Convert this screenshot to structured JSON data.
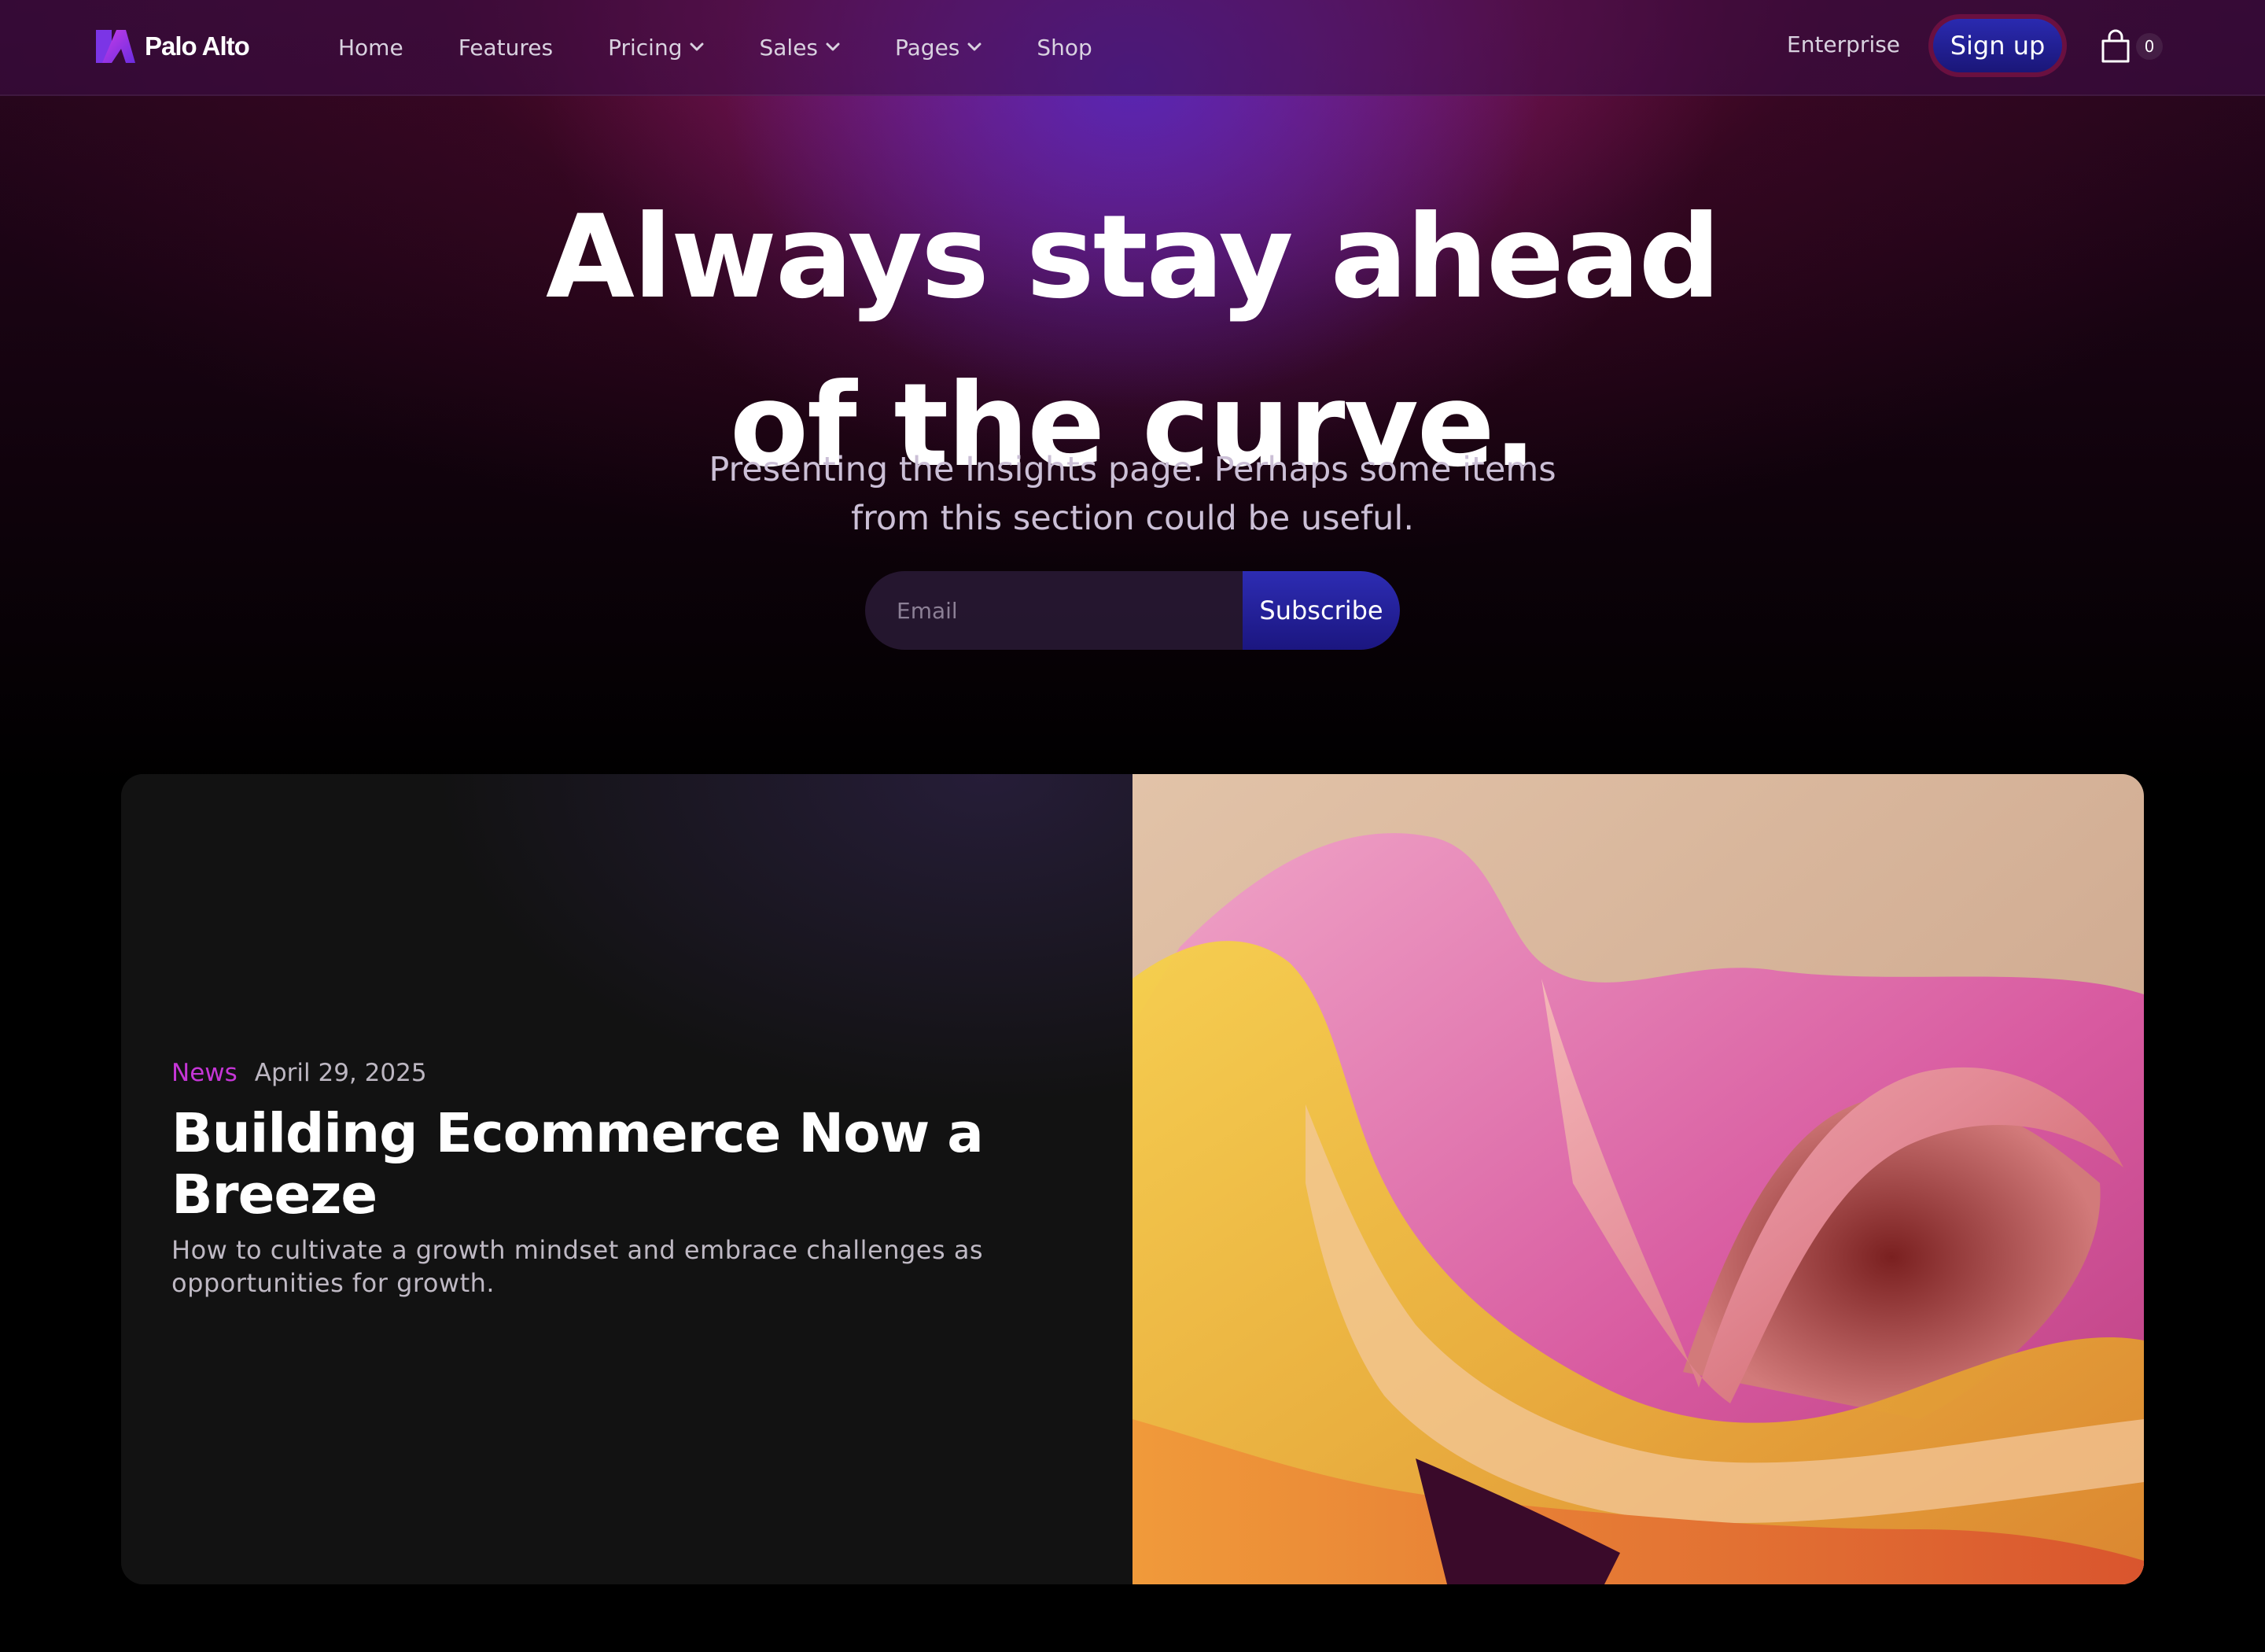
{
  "brand": {
    "name": "Palo Alto"
  },
  "nav": {
    "items": [
      {
        "label": "Home",
        "dropdown": false
      },
      {
        "label": "Features",
        "dropdown": false
      },
      {
        "label": "Pricing",
        "dropdown": true
      },
      {
        "label": "Sales",
        "dropdown": true
      },
      {
        "label": "Pages",
        "dropdown": true
      },
      {
        "label": "Shop",
        "dropdown": false
      }
    ],
    "enterprise_label": "Enterprise",
    "signup_label": "Sign up",
    "cart_count": "0"
  },
  "hero": {
    "title_line1": "Always stay ahead",
    "title_line2": "of the curve.",
    "subtitle": "Presenting the Insights page. Perhaps some items from this section could be useful.",
    "email_placeholder": "Email",
    "subscribe_label": "Subscribe"
  },
  "featured_post": {
    "category": "News",
    "date": "April 29, 2025",
    "title": "Building Ecommerce Now a Breeze",
    "excerpt": "How to cultivate a growth mindset and embrace challenges as opportunities for growth."
  },
  "colors": {
    "accent_tag": "#c536d6",
    "button_blue": "#2d2cb3",
    "background": "#000000",
    "card_bg": "#121212"
  },
  "icons": {
    "cart": "shopping-bag-icon",
    "dropdown": "chevron-down-icon",
    "logo": "palo-alto-logo-icon"
  }
}
